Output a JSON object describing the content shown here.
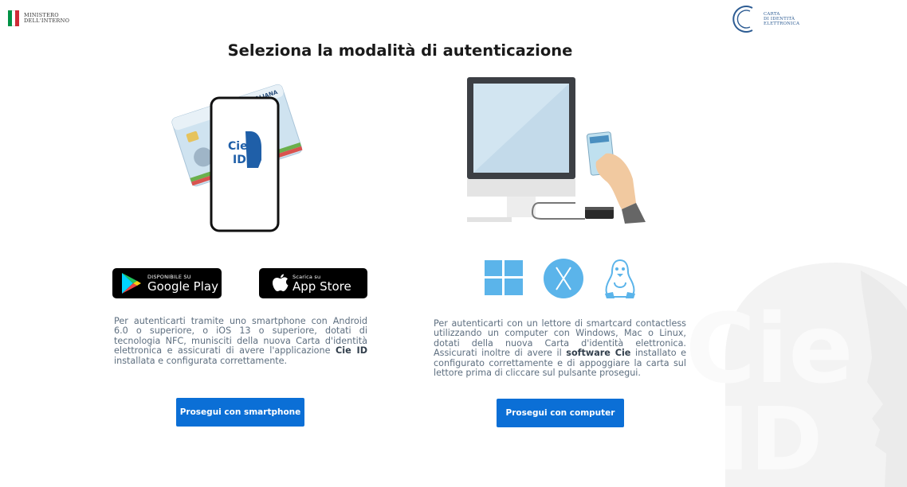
{
  "header": {
    "ministry_line1": "MINISTERO",
    "ministry_line2": "DELL'INTERNO",
    "cie_line1": "CARTA",
    "cie_line2": "DI IDENTITÀ",
    "cie_line3": "ELETTRONICA"
  },
  "title": "Seleziona la modalità di autenticazione",
  "illustrations": {
    "card_top_text": "REPUBBLICA ITALIANA",
    "app_label_1": "Cie",
    "app_label_2": "ID"
  },
  "stores": {
    "google_small": "DISPONIBILE SU",
    "google_big": "Google Play",
    "apple_small": "Scarica su",
    "apple_big": "App Store"
  },
  "smartphone": {
    "desc_before": "Per autenticarti tramite uno smartphone con Android 6.0 o superiore, o iOS 13 o superiore, dotati di tecnologia NFC, munisciti della nuova Carta d'identità elettronica e assicurati di avere l'applicazione ",
    "desc_bold": "Cie ID",
    "desc_after": " installata e configurata correttamente.",
    "button": "Prosegui con smartphone"
  },
  "computer": {
    "desc_before": "Per autenticarti con un lettore di smartcard contactless utilizzando un computer con Windows, Mac o Linux, dotati della nuova Carta d'identità elettronica. Assicurati inoltre di avere il ",
    "desc_bold": "software Cie",
    "desc_after": " installato e configurato correttamente e di appoggiare la carta sul lettore prima di cliccare sul pulsante prosegui.",
    "button": "Prosegui con computer"
  },
  "watermark": {
    "line1": "Cie",
    "line2": "ID"
  },
  "colors": {
    "primary": "#0b6fd6",
    "os_icon": "#5bb4ea",
    "cie_blue": "#1f5fa8",
    "flag_green": "#009246",
    "flag_red": "#ce2b37"
  }
}
